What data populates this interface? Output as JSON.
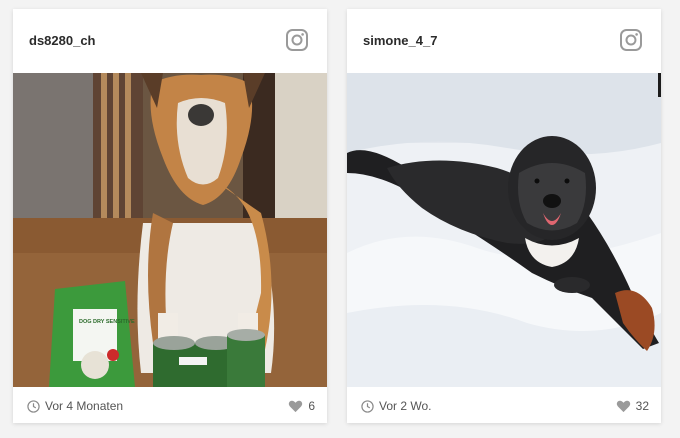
{
  "posts": [
    {
      "username": "ds8280_ch",
      "time": "Vor 4 Monaten",
      "likes": "6",
      "bag_label": "DOG DRY SENSITIVE"
    },
    {
      "username": "simone_4_7",
      "time": "Vor 2 Wo.",
      "likes": "32"
    }
  ],
  "icons": {
    "brand": "instagram-icon",
    "time": "clock-icon",
    "likes": "heart-icon"
  },
  "colors": {
    "icon_gray": "#9a9a9a",
    "text": "#2b2b2b",
    "bag_green": "#3c9a3c"
  }
}
